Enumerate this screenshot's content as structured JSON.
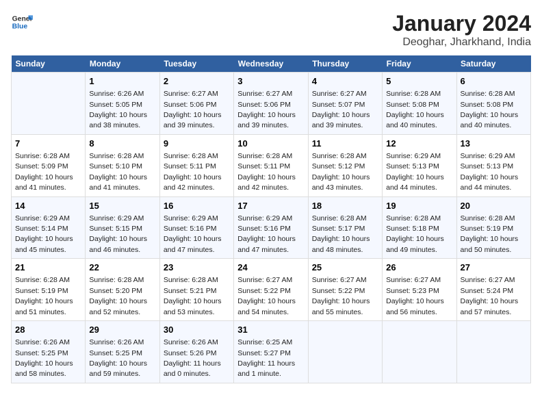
{
  "header": {
    "logo_line1": "General",
    "logo_line2": "Blue",
    "title": "January 2024",
    "subtitle": "Deoghar, Jharkhand, India"
  },
  "days_of_week": [
    "Sunday",
    "Monday",
    "Tuesday",
    "Wednesday",
    "Thursday",
    "Friday",
    "Saturday"
  ],
  "weeks": [
    [
      {
        "day": "",
        "info": ""
      },
      {
        "day": "1",
        "info": "Sunrise: 6:26 AM\nSunset: 5:05 PM\nDaylight: 10 hours\nand 38 minutes."
      },
      {
        "day": "2",
        "info": "Sunrise: 6:27 AM\nSunset: 5:06 PM\nDaylight: 10 hours\nand 39 minutes."
      },
      {
        "day": "3",
        "info": "Sunrise: 6:27 AM\nSunset: 5:06 PM\nDaylight: 10 hours\nand 39 minutes."
      },
      {
        "day": "4",
        "info": "Sunrise: 6:27 AM\nSunset: 5:07 PM\nDaylight: 10 hours\nand 39 minutes."
      },
      {
        "day": "5",
        "info": "Sunrise: 6:28 AM\nSunset: 5:08 PM\nDaylight: 10 hours\nand 40 minutes."
      },
      {
        "day": "6",
        "info": "Sunrise: 6:28 AM\nSunset: 5:08 PM\nDaylight: 10 hours\nand 40 minutes."
      }
    ],
    [
      {
        "day": "7",
        "info": "Sunrise: 6:28 AM\nSunset: 5:09 PM\nDaylight: 10 hours\nand 41 minutes."
      },
      {
        "day": "8",
        "info": "Sunrise: 6:28 AM\nSunset: 5:10 PM\nDaylight: 10 hours\nand 41 minutes."
      },
      {
        "day": "9",
        "info": "Sunrise: 6:28 AM\nSunset: 5:11 PM\nDaylight: 10 hours\nand 42 minutes."
      },
      {
        "day": "10",
        "info": "Sunrise: 6:28 AM\nSunset: 5:11 PM\nDaylight: 10 hours\nand 42 minutes."
      },
      {
        "day": "11",
        "info": "Sunrise: 6:28 AM\nSunset: 5:12 PM\nDaylight: 10 hours\nand 43 minutes."
      },
      {
        "day": "12",
        "info": "Sunrise: 6:29 AM\nSunset: 5:13 PM\nDaylight: 10 hours\nand 44 minutes."
      },
      {
        "day": "13",
        "info": "Sunrise: 6:29 AM\nSunset: 5:13 PM\nDaylight: 10 hours\nand 44 minutes."
      }
    ],
    [
      {
        "day": "14",
        "info": "Sunrise: 6:29 AM\nSunset: 5:14 PM\nDaylight: 10 hours\nand 45 minutes."
      },
      {
        "day": "15",
        "info": "Sunrise: 6:29 AM\nSunset: 5:15 PM\nDaylight: 10 hours\nand 46 minutes."
      },
      {
        "day": "16",
        "info": "Sunrise: 6:29 AM\nSunset: 5:16 PM\nDaylight: 10 hours\nand 47 minutes."
      },
      {
        "day": "17",
        "info": "Sunrise: 6:29 AM\nSunset: 5:16 PM\nDaylight: 10 hours\nand 47 minutes."
      },
      {
        "day": "18",
        "info": "Sunrise: 6:28 AM\nSunset: 5:17 PM\nDaylight: 10 hours\nand 48 minutes."
      },
      {
        "day": "19",
        "info": "Sunrise: 6:28 AM\nSunset: 5:18 PM\nDaylight: 10 hours\nand 49 minutes."
      },
      {
        "day": "20",
        "info": "Sunrise: 6:28 AM\nSunset: 5:19 PM\nDaylight: 10 hours\nand 50 minutes."
      }
    ],
    [
      {
        "day": "21",
        "info": "Sunrise: 6:28 AM\nSunset: 5:19 PM\nDaylight: 10 hours\nand 51 minutes."
      },
      {
        "day": "22",
        "info": "Sunrise: 6:28 AM\nSunset: 5:20 PM\nDaylight: 10 hours\nand 52 minutes."
      },
      {
        "day": "23",
        "info": "Sunrise: 6:28 AM\nSunset: 5:21 PM\nDaylight: 10 hours\nand 53 minutes."
      },
      {
        "day": "24",
        "info": "Sunrise: 6:27 AM\nSunset: 5:22 PM\nDaylight: 10 hours\nand 54 minutes."
      },
      {
        "day": "25",
        "info": "Sunrise: 6:27 AM\nSunset: 5:22 PM\nDaylight: 10 hours\nand 55 minutes."
      },
      {
        "day": "26",
        "info": "Sunrise: 6:27 AM\nSunset: 5:23 PM\nDaylight: 10 hours\nand 56 minutes."
      },
      {
        "day": "27",
        "info": "Sunrise: 6:27 AM\nSunset: 5:24 PM\nDaylight: 10 hours\nand 57 minutes."
      }
    ],
    [
      {
        "day": "28",
        "info": "Sunrise: 6:26 AM\nSunset: 5:25 PM\nDaylight: 10 hours\nand 58 minutes."
      },
      {
        "day": "29",
        "info": "Sunrise: 6:26 AM\nSunset: 5:25 PM\nDaylight: 10 hours\nand 59 minutes."
      },
      {
        "day": "30",
        "info": "Sunrise: 6:26 AM\nSunset: 5:26 PM\nDaylight: 11 hours\nand 0 minutes."
      },
      {
        "day": "31",
        "info": "Sunrise: 6:25 AM\nSunset: 5:27 PM\nDaylight: 11 hours\nand 1 minute."
      },
      {
        "day": "",
        "info": ""
      },
      {
        "day": "",
        "info": ""
      },
      {
        "day": "",
        "info": ""
      }
    ]
  ]
}
